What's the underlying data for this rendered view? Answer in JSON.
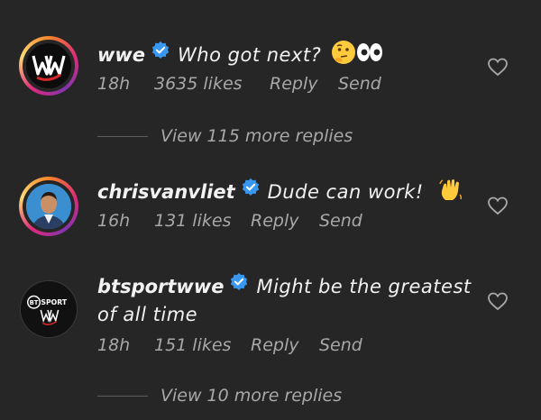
{
  "comments": [
    {
      "username": "wwe",
      "text": "Who got next?",
      "emoji": [
        "thinking-face-emoji",
        "eyes-emoji"
      ],
      "age": "18h",
      "likes": "3635 likes",
      "reply": "Reply",
      "send": "Send",
      "avatar": "wwe-logo"
    },
    {
      "username": "chrisvanvliet",
      "text": "Dude can work!",
      "emoji": [
        "waving-hand-emoji"
      ],
      "age": "16h",
      "likes": "131 likes",
      "reply": "Reply",
      "send": "Send",
      "avatar": "person-photo"
    },
    {
      "username": "btsportwwe",
      "text": "Might be the greatest",
      "text_cont": "of all time",
      "age": "18h",
      "likes": "151 likes",
      "reply": "Reply",
      "send": "Send",
      "avatar": "bt-sport-logo",
      "avatar_text": "BT SPORT"
    }
  ],
  "view_more": [
    "View 115 more replies",
    "View 10 more replies"
  ],
  "colors": {
    "background": "#262626",
    "verified": "#3897f0",
    "muted": "#a8a8a8"
  }
}
